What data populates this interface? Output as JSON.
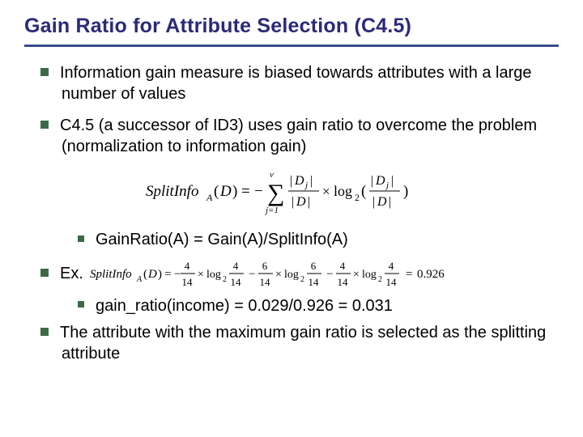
{
  "title": "Gain Ratio for Attribute Selection (C4.5)",
  "bullets": {
    "b1": "Information gain measure is biased towards attributes with a large number of values",
    "b2": "C4.5 (a successor of ID3) uses gain ratio to overcome the problem (normalization to information gain)",
    "sub_gainratio": "GainRatio(A) = Gain(A)/SplitInfo(A)",
    "ex_label": "Ex.",
    "sub_calc": "gain_ratio(income) = 0.029/0.926 = 0.031",
    "b4": "The attribute with the maximum gain ratio is selected as the splitting attribute"
  },
  "formulas": {
    "splitinfo_def": {
      "lhs_name": "SplitInfo",
      "lhs_sub": "A",
      "lhs_arg": "D",
      "sum_lower": "j=1",
      "sum_upper": "v",
      "frac1_num": "|D_j|",
      "frac1_den": "|D|",
      "logbase": "2",
      "frac2_num": "|D_j|",
      "frac2_den": "|D|"
    },
    "splitinfo_ex": {
      "lhs_name": "SplitInfo",
      "lhs_sub": "A",
      "lhs_arg": "D",
      "t1_num": "4",
      "t1_den": "14",
      "t1_log_num": "4",
      "t1_log_den": "14",
      "t2_num": "6",
      "t2_den": "14",
      "t2_log_num": "6",
      "t2_log_den": "14",
      "t3_num": "4",
      "t3_den": "14",
      "t3_log_num": "4",
      "t3_log_den": "14",
      "result": "0.926"
    }
  }
}
